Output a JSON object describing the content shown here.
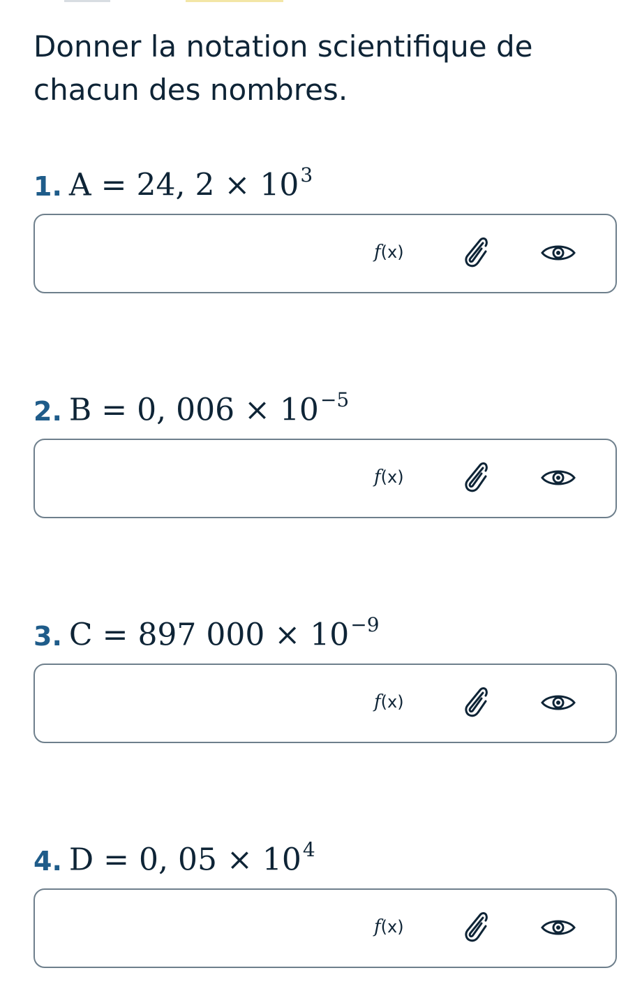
{
  "instruction": "Donner la notation scientifique de chacun des nombres.",
  "questions": [
    {
      "number": "1.",
      "variable": "A",
      "equals": "=",
      "mantissa": "24, 2",
      "times": "×",
      "base": "10",
      "exponent": "3",
      "answer_value": "",
      "tools": {
        "formula": "(x)",
        "attach": "paperclip-icon",
        "preview": "eye-icon"
      }
    },
    {
      "number": "2.",
      "variable": "B",
      "equals": "=",
      "mantissa": "0, 006",
      "times": "×",
      "base": "10",
      "exponent": "−5",
      "answer_value": "",
      "tools": {
        "formula": "(x)",
        "attach": "paperclip-icon",
        "preview": "eye-icon"
      }
    },
    {
      "number": "3.",
      "variable": "C",
      "equals": "=",
      "mantissa": "897 000",
      "times": "×",
      "base": "10",
      "exponent": "−9",
      "answer_value": "",
      "tools": {
        "formula": "(x)",
        "attach": "paperclip-icon",
        "preview": "eye-icon"
      }
    },
    {
      "number": "4.",
      "variable": "D",
      "equals": "=",
      "mantissa": "0, 05",
      "times": "×",
      "base": "10",
      "exponent": "4",
      "answer_value": "",
      "tools": {
        "formula": "(x)",
        "attach": "paperclip-icon",
        "preview": "eye-icon"
      }
    }
  ],
  "formula_button_prefix": "f",
  "colors": {
    "number_accent": "#1f5c8a",
    "text": "#0e2436",
    "box_border": "#6e7f8c",
    "top_bar_gray": "#d8dde2",
    "top_bar_yellow": "#f3e6a6"
  }
}
